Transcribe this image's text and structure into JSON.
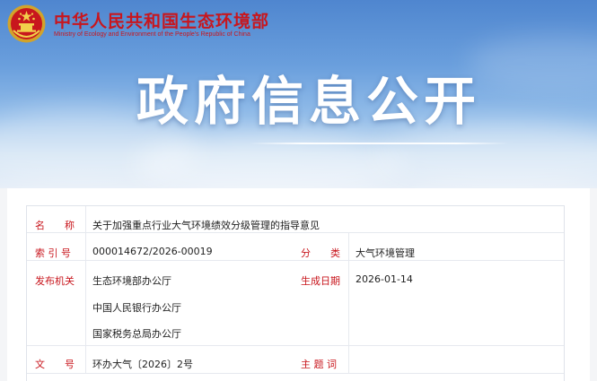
{
  "header": {
    "brand_cn": "中华人民共和国生态环境部",
    "brand_en": "Ministry of Ecology and Environment of the People's Republic of China",
    "emblem_icon": "national-emblem-icon",
    "title": "政府信息公开"
  },
  "colors": {
    "accent_red": "#c8161d",
    "sky_blue": "#5b8fd4",
    "label_red": "#c8161d"
  },
  "info": {
    "name_label": "名　　称",
    "name_value": "关于加强重点行业大气环境绩效分级管理的指导意见",
    "index_label": "索 引 号",
    "index_value": "000014672/2026-00019",
    "category_label": "分　　类",
    "category_value": "大气环境管理",
    "publisher_label": "发布机关",
    "publishers": [
      "生态环境部办公厅",
      "中国人民银行办公厅",
      "国家税务总局办公厅"
    ],
    "date_label": "生成日期",
    "date_value": "2026-01-14",
    "docno_label": "文　　号",
    "docno_value": "环办大气〔2026〕2号",
    "keywords_label": "主 题 词",
    "keywords_value": ""
  }
}
